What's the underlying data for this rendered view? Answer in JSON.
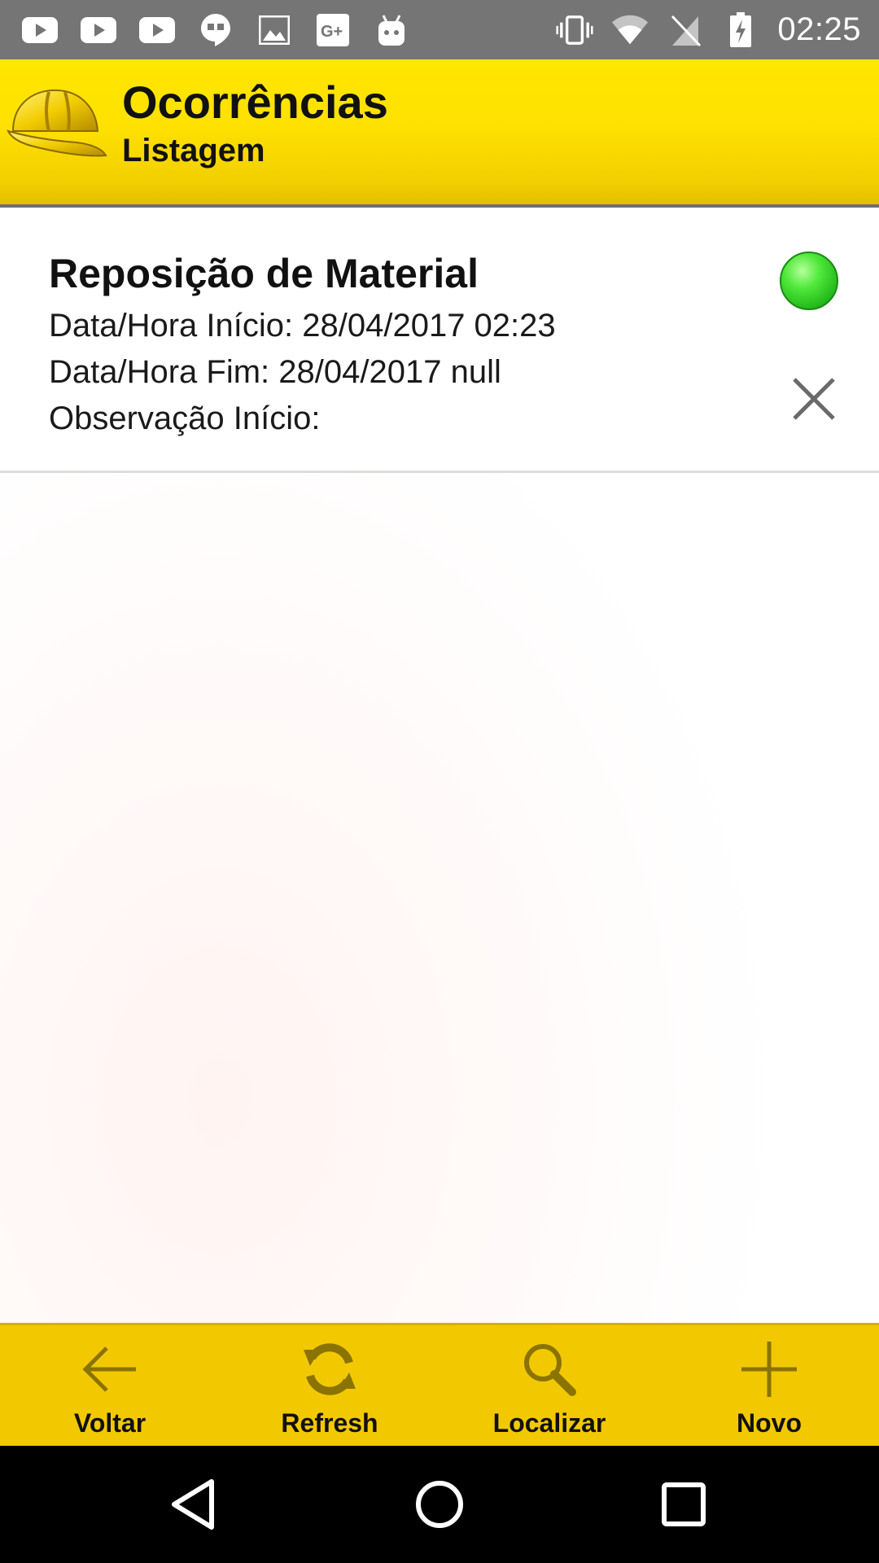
{
  "status_bar": {
    "time": "02:25",
    "left_icons": [
      "youtube-icon",
      "youtube-icon",
      "youtube-icon",
      "hangouts-icon",
      "gallery-icon",
      "google-plus-icon",
      "android-icon"
    ],
    "right_icons": [
      "vibrate-icon",
      "wifi-icon",
      "no-sim-icon",
      "battery-charging-icon"
    ]
  },
  "header": {
    "title": "Ocorrências",
    "subtitle": "Listagem",
    "logo": "hard-hat-icon",
    "background": "#ffe100"
  },
  "list": {
    "items": [
      {
        "title": "Reposição de Material",
        "start": "Data/Hora Início: 28/04/2017 02:23",
        "end": "Data/Hora Fim: 28/04/2017 null",
        "observation": "Observação Início:",
        "status_color": "#22b81a"
      }
    ]
  },
  "toolbar": {
    "back_label": "Voltar",
    "refresh_label": "Refresh",
    "search_label": "Localizar",
    "new_label": "Novo",
    "icon_color": "#8a7300",
    "background": "#f2c900"
  },
  "nav_bar": {
    "buttons": [
      "back-icon",
      "home-icon",
      "recents-icon"
    ]
  }
}
